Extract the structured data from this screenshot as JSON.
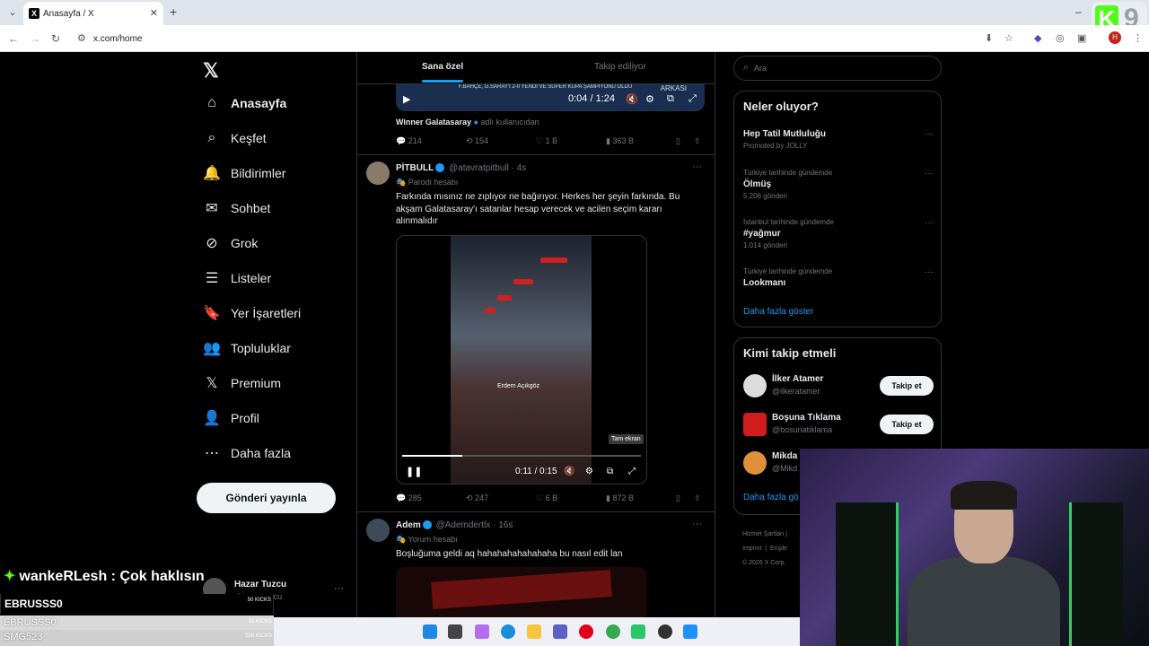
{
  "browser": {
    "tab_title": "Anasayfa / X",
    "url": "x.com/home",
    "profile_initial": "H",
    "overlay_number": "9"
  },
  "nav": {
    "items": [
      {
        "label": "Anasayfa",
        "icon": "home-icon"
      },
      {
        "label": "Keşfet",
        "icon": "search-icon"
      },
      {
        "label": "Bildirimler",
        "icon": "bell-icon"
      },
      {
        "label": "Sohbet",
        "icon": "mail-icon"
      },
      {
        "label": "Grok",
        "icon": "grok-icon"
      },
      {
        "label": "Listeler",
        "icon": "list-icon"
      },
      {
        "label": "Yer İşaretleri",
        "icon": "bookmark-icon"
      },
      {
        "label": "Topluluklar",
        "icon": "people-icon"
      },
      {
        "label": "Premium",
        "icon": "x-icon"
      },
      {
        "label": "Profil",
        "icon": "person-icon"
      },
      {
        "label": "Daha fazla",
        "icon": "more-icon"
      }
    ],
    "post_button": "Gönderi yayınla",
    "account_name": "Hazar Tuzcu",
    "account_handle": "@hazartuzcu"
  },
  "feed": {
    "tabs": {
      "for_you": "Sana özel",
      "following": "Takip ediliyor"
    },
    "video1": {
      "caption": "F.BAHÇE, G.SARAY'I 2-0 YENDİ VE SÜPER KUPA ŞAMPİYONU OLDU",
      "caption2": "ARKASI",
      "time": "0:04 / 1:24"
    },
    "quote_line": {
      "name": "Winner Galatasaray",
      "suffix": "adlı kullanıcıdan"
    },
    "tweet0_actions": {
      "reply": "214",
      "retweet": "154",
      "like": "1 B",
      "views": "363 B"
    },
    "tweet1": {
      "name": "PİTBULL",
      "handle": "@atavratpitbull · 4s",
      "label": "Parodi hesabı",
      "text": "Farkında mısınız ne zıplıyor ne bağırıyor. Herkes her şeyin farkında. Bu akşam Galatasaray'ı satanlar hesap verecek ve acilen seçim kararı alınmalıdır",
      "video_subtitle": "Erdem Açıkgöz",
      "video_time": "0:11 / 0:15",
      "video_progress": 0.25,
      "tooltip": "Tam ekran",
      "actions": {
        "reply": "285",
        "retweet": "247",
        "like": "6 B",
        "views": "872 B"
      }
    },
    "tweet2": {
      "name": "Adem",
      "handle": "@Ademdertlx · 16s",
      "label": "Yorum hesabı",
      "text": "Boşluğuma geldi aq hahahahahahahaha bu nasıl edit lan"
    }
  },
  "sidebar": {
    "search_placeholder": "Ara",
    "trends_title": "Neler oluyor?",
    "trends": [
      {
        "title": "Hep Tatil Mutluluğu",
        "context": "Promoted by JOLLY",
        "count": ""
      },
      {
        "context": "Türkiye tarihinde gündemde",
        "title": "Ölmüş",
        "count": "5.206 gönderi"
      },
      {
        "context": "İstanbul tarihinde gündemde",
        "title": "#yağmur",
        "count": "1.014 gönderi"
      },
      {
        "context": "Türkiye tarihinde gündemde",
        "title": "Lookmanı",
        "count": ""
      }
    ],
    "show_more": "Daha fazla göster",
    "follow_title": "Kimi takip etmeli",
    "follow": [
      {
        "name": "İlker Atamer",
        "handle": "@ilkeratamer",
        "button": "Takip et"
      },
      {
        "name": "Boşuna Tıklama",
        "handle": "@bosunatiklama",
        "button": "Takip et"
      },
      {
        "name": "Mikda",
        "handle": "@Mikd",
        "button": ""
      }
    ],
    "follow_show_more": "Daha fazla gö",
    "footer": [
      "Hizmet Şartları",
      "Imprint",
      "Erişile",
      "© 2026 X Corp."
    ]
  },
  "stream_overlay": {
    "chat_user": "wankeRLesh",
    "chat_text": ": Çok haklısın",
    "gifts": [
      {
        "user": "EBRUSSS0",
        "kicks": "50 KICKS"
      },
      {
        "user": "EBRUSSS0",
        "kicks": "10 KICKS"
      },
      {
        "user": "SMG523",
        "kicks": "500 KICKS"
      }
    ]
  }
}
